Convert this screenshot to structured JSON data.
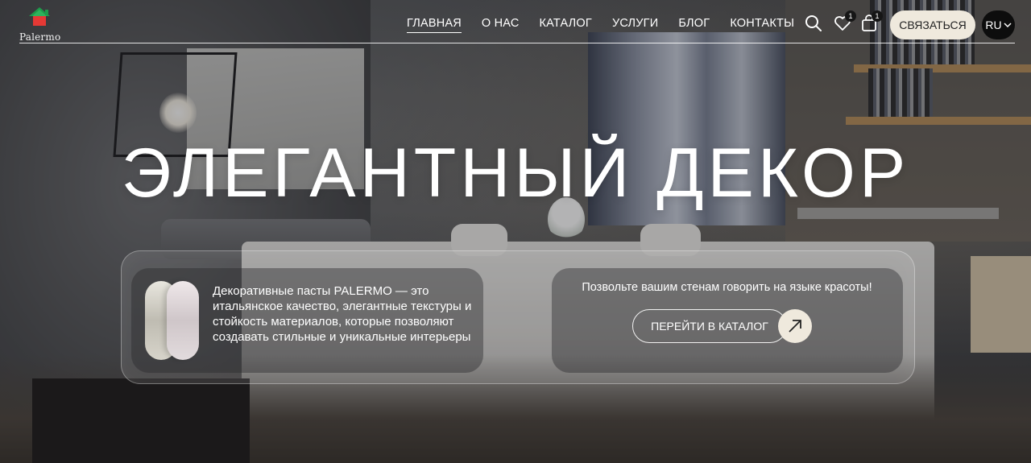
{
  "brand": {
    "logo_text": "Palermo"
  },
  "nav": {
    "items": [
      {
        "label": "ГЛАВНАЯ",
        "active": true
      },
      {
        "label": "О НАС"
      },
      {
        "label": "КАТАЛОГ"
      },
      {
        "label": "УСЛУГИ"
      },
      {
        "label": "БЛОГ"
      },
      {
        "label": "КОНТАКТЫ"
      }
    ]
  },
  "header": {
    "search_icon": "search-icon",
    "wishlist_count": "1",
    "cart_count": "1",
    "contact_label": "СВЯЗАТЬСЯ",
    "lang_label": "RU"
  },
  "hero": {
    "title": "ЭЛЕГАНТНЫЙ ДЕКОР",
    "description": "Декоративные пасты PALERMO — это итальянское качество, элегантные текстуры и стойкость материалов, которые позволяют создавать стильные и уникальные интерьеры",
    "tagline": "Позвольте вашим стенам говорить на языке красоты!",
    "cta_label": "ПЕРЕЙТИ В КАТАЛОГ"
  },
  "colors": {
    "accent_button": "#efe9dd",
    "lang_bg": "#0d0d0d",
    "logo_green": "#1e9a4a",
    "logo_red": "#e53935"
  }
}
